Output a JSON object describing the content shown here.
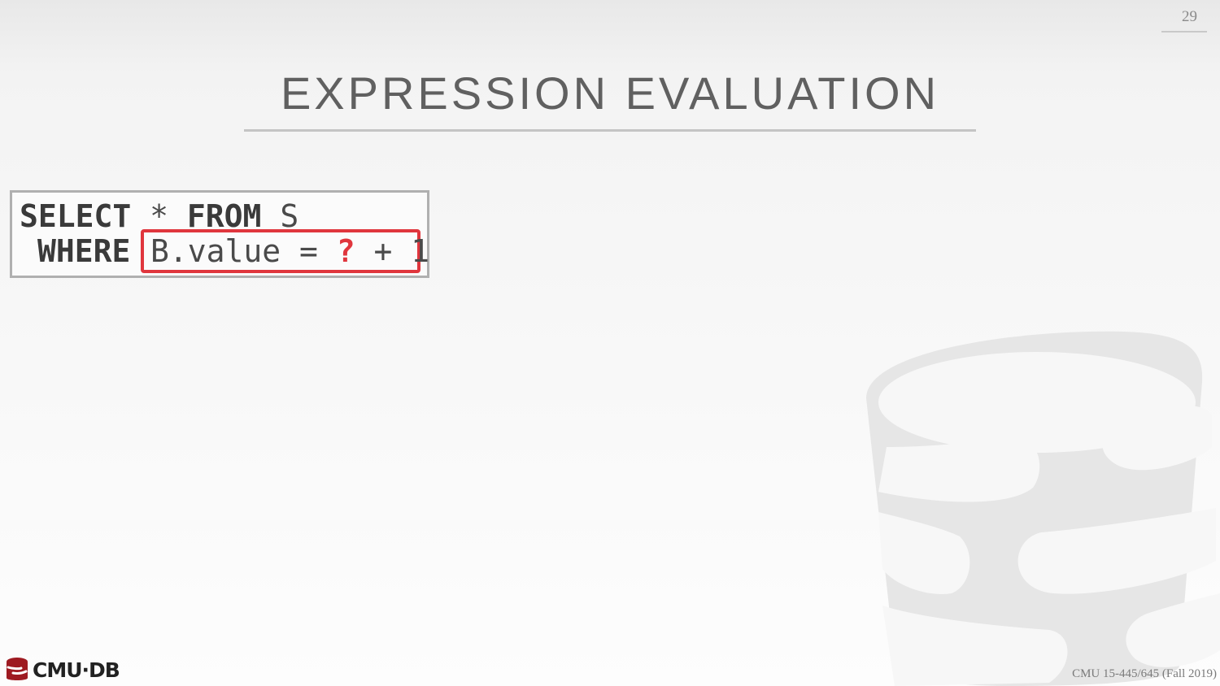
{
  "slide": {
    "number": "29",
    "title": "EXPRESSION EVALUATION"
  },
  "code": {
    "kw_select": "SELECT",
    "line1_mid": " * ",
    "kw_from": "FROM",
    "line1_end": " S",
    "kw_where": "WHERE",
    "expr_before": "B.value = ",
    "placeholder": "?",
    "expr_after": " + 1"
  },
  "logo": {
    "text": "CMU·DB"
  },
  "footer": {
    "course": "CMU 15-445/645 (Fall 2019)"
  },
  "colors": {
    "accent": "#e0363d",
    "logo_red": "#9e1a21"
  }
}
